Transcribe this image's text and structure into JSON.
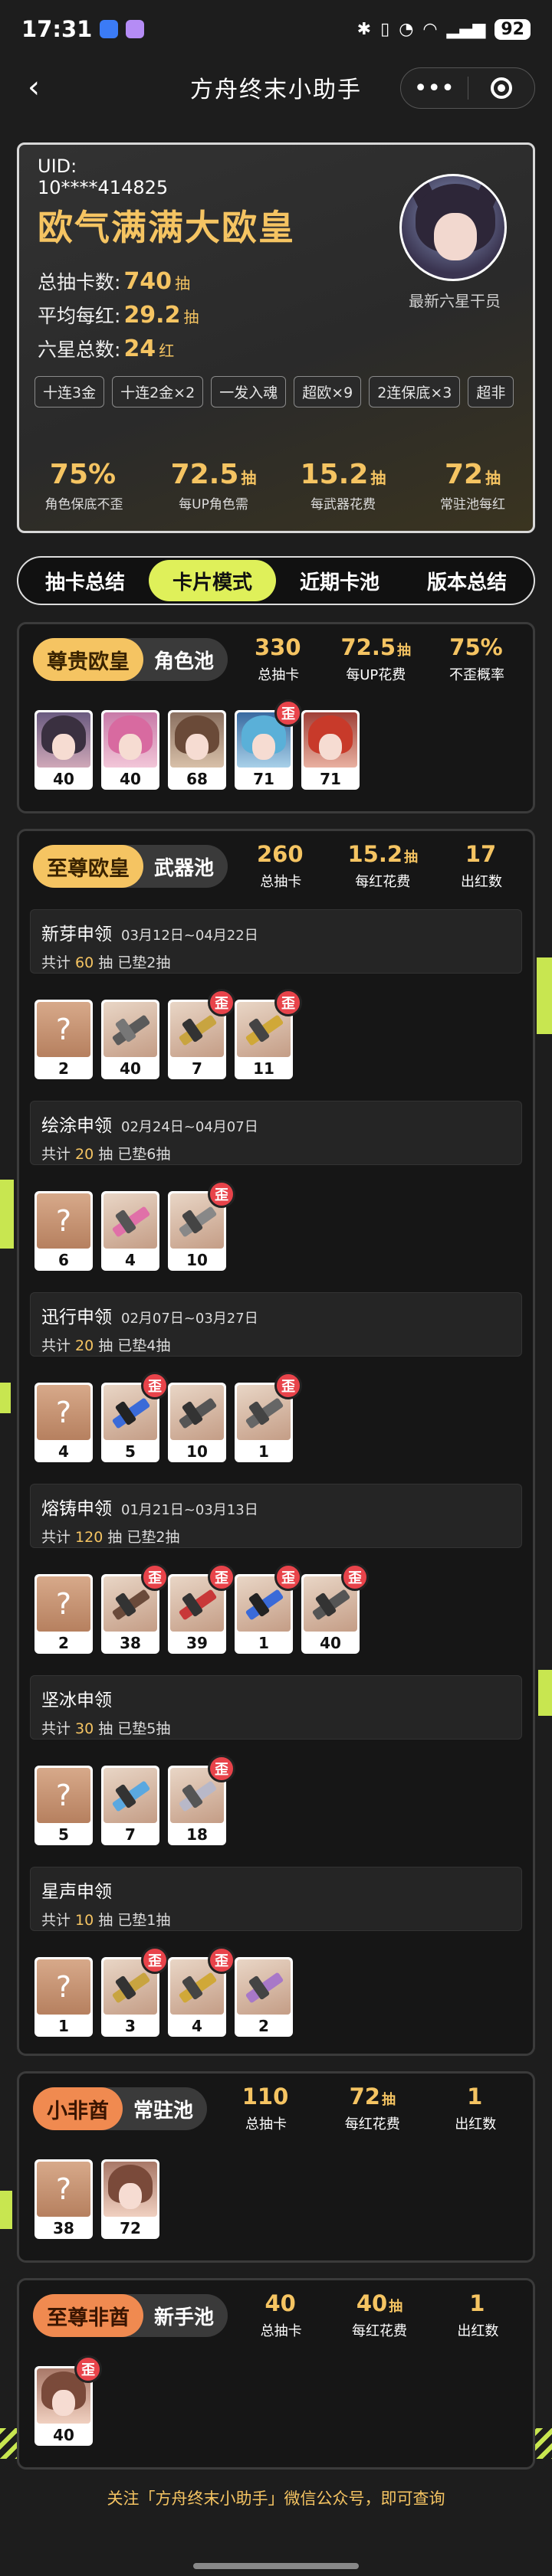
{
  "status": {
    "time": "17:31",
    "battery": "92"
  },
  "nav": {
    "title": "方舟终末小助手",
    "more": "•••"
  },
  "profile": {
    "uid_label": "UID:",
    "uid": "10****414825",
    "title": "欧气满满大欧皇",
    "stats": [
      {
        "label": "总抽卡数:",
        "value": "740",
        "unit": "抽"
      },
      {
        "label": "平均每红:",
        "value": "29.2",
        "unit": "抽"
      },
      {
        "label": "六星总数:",
        "value": "24",
        "unit": "红"
      }
    ],
    "avatar_caption": "最新六星干员",
    "tags": [
      "十连3金",
      "十连2金×2",
      "一发入魂",
      "超欧×9",
      "2连保底×3",
      "超非"
    ],
    "metrics": [
      {
        "value": "75%",
        "unit": "",
        "label": "角色保底不歪"
      },
      {
        "value": "72.5",
        "unit": "抽",
        "label": "每UP角色需"
      },
      {
        "value": "15.2",
        "unit": "抽",
        "label": "每武器花费"
      },
      {
        "value": "72",
        "unit": "抽",
        "label": "常驻池每红"
      }
    ]
  },
  "tabs": [
    "抽卡总结",
    "卡片模式",
    "近期卡池",
    "版本总结"
  ],
  "pools": {
    "character": {
      "badge": "尊贵欧皇",
      "type": "角色池",
      "stats": [
        {
          "value": "330",
          "unit": "",
          "label": "总抽卡"
        },
        {
          "value": "72.5",
          "unit": "抽",
          "label": "每UP花费"
        },
        {
          "value": "75%",
          "unit": "",
          "label": "不歪概率"
        }
      ],
      "cards": [
        {
          "num": "40",
          "wai": ""
        },
        {
          "num": "40",
          "wai": ""
        },
        {
          "num": "68",
          "wai": ""
        },
        {
          "num": "71",
          "wai": "歪"
        },
        {
          "num": "71",
          "wai": ""
        }
      ]
    },
    "weapon": {
      "badge": "至尊欧皇",
      "type": "武器池",
      "stats": [
        {
          "value": "260",
          "unit": "",
          "label": "总抽卡"
        },
        {
          "value": "15.2",
          "unit": "抽",
          "label": "每红花费"
        },
        {
          "value": "17",
          "unit": "",
          "label": "出红数"
        }
      ],
      "banners": [
        {
          "name": "新芽申领",
          "date": "03月12日~04月22日",
          "total_label": "共计",
          "count": "60",
          "pulls_label": "抽",
          "pity": "已垫2抽",
          "cards": [
            {
              "num": "2",
              "wai": "",
              "q": "?"
            },
            {
              "num": "40",
              "wai": ""
            },
            {
              "num": "7",
              "wai": "歪"
            },
            {
              "num": "11",
              "wai": "歪"
            }
          ]
        },
        {
          "name": "绘涂申领",
          "date": "02月24日~04月07日",
          "total_label": "共计",
          "count": "20",
          "pulls_label": "抽",
          "pity": "已垫6抽",
          "cards": [
            {
              "num": "6",
              "wai": "",
              "q": "?"
            },
            {
              "num": "4",
              "wai": ""
            },
            {
              "num": "10",
              "wai": "歪"
            }
          ]
        },
        {
          "name": "迅行申领",
          "date": "02月07日~03月27日",
          "total_label": "共计",
          "count": "20",
          "pulls_label": "抽",
          "pity": "已垫4抽",
          "cards": [
            {
              "num": "4",
              "wai": "",
              "q": "?"
            },
            {
              "num": "5",
              "wai": "歪"
            },
            {
              "num": "10",
              "wai": ""
            },
            {
              "num": "1",
              "wai": "歪"
            }
          ]
        },
        {
          "name": "熔铸申领",
          "date": "01月21日~03月13日",
          "total_label": "共计",
          "count": "120",
          "pulls_label": "抽",
          "pity": "已垫2抽",
          "cards": [
            {
              "num": "2",
              "wai": "",
              "q": "?"
            },
            {
              "num": "38",
              "wai": "歪"
            },
            {
              "num": "39",
              "wai": "歪"
            },
            {
              "num": "1",
              "wai": "歪"
            },
            {
              "num": "40",
              "wai": "歪"
            }
          ]
        },
        {
          "name": "坚冰申领",
          "date": "",
          "total_label": "共计",
          "count": "30",
          "pulls_label": "抽",
          "pity": "已垫5抽",
          "cards": [
            {
              "num": "5",
              "wai": "",
              "q": "?"
            },
            {
              "num": "7",
              "wai": ""
            },
            {
              "num": "18",
              "wai": "歪"
            }
          ]
        },
        {
          "name": "星声申领",
          "date": "",
          "total_label": "共计",
          "count": "10",
          "pulls_label": "抽",
          "pity": "已垫1抽",
          "cards": [
            {
              "num": "1",
              "wai": "",
              "q": "?"
            },
            {
              "num": "3",
              "wai": "歪"
            },
            {
              "num": "4",
              "wai": "歪"
            },
            {
              "num": "2",
              "wai": ""
            }
          ]
        }
      ]
    },
    "standard": {
      "badge": "小非酋",
      "type": "常驻池",
      "stats": [
        {
          "value": "110",
          "unit": "",
          "label": "总抽卡"
        },
        {
          "value": "72",
          "unit": "抽",
          "label": "每红花费"
        },
        {
          "value": "1",
          "unit": "",
          "label": "出红数"
        }
      ],
      "cards": [
        {
          "num": "38",
          "wai": "",
          "q": "?"
        },
        {
          "num": "72",
          "wai": ""
        }
      ]
    },
    "newbie": {
      "badge": "至尊非酋",
      "type": "新手池",
      "stats": [
        {
          "value": "40",
          "unit": "",
          "label": "总抽卡"
        },
        {
          "value": "40",
          "unit": "抽",
          "label": "每红花费"
        },
        {
          "value": "1",
          "unit": "",
          "label": "出红数"
        }
      ],
      "cards": [
        {
          "num": "40",
          "wai": "歪"
        }
      ]
    }
  },
  "footer": "关注「方舟终末小助手」微信公众号，即可查询",
  "colors": {
    "accent": "#dff05a",
    "gold": "#f5c462",
    "wai_red": "#e8434a",
    "badge_gold": "#f5c462",
    "badge_orange": "#f08a50"
  }
}
